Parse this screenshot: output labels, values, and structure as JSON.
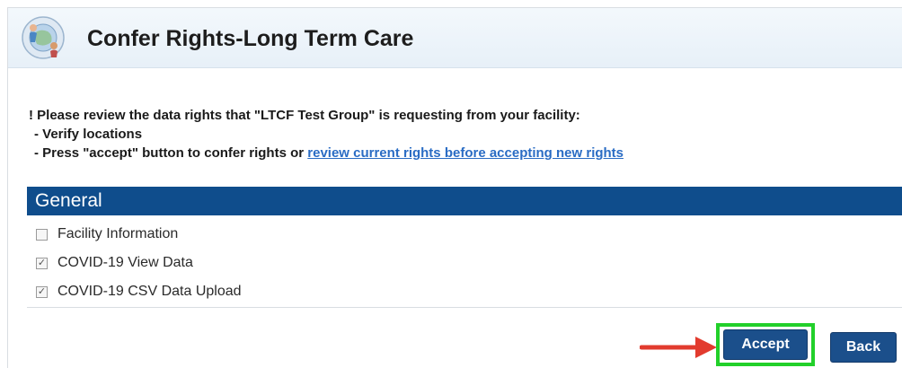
{
  "header": {
    "title": "Confer Rights-Long Term Care",
    "logo_icon": "nhsn-people-globe-logo"
  },
  "notice": {
    "intro": "! Please review the data rights that \"LTCF Test Group\" is requesting from your facility:",
    "step1": "- Verify locations",
    "step2_prefix": "- Press \"accept\" button to confer rights or ",
    "step2_link": "review current rights before accepting new rights"
  },
  "section": {
    "title": "General"
  },
  "rights": [
    {
      "label": "Facility Information",
      "checked": false
    },
    {
      "label": "COVID-19 View Data",
      "checked": true
    },
    {
      "label": "COVID-19 CSV Data Upload",
      "checked": true
    }
  ],
  "actions": {
    "accept_label": "Accept",
    "back_label": "Back"
  },
  "colors": {
    "section_header": "#0f4d8c",
    "button": "#1b4f8b",
    "highlight": "#22d02a",
    "arrow": "#e23b2e",
    "link": "#2a6cc4"
  }
}
